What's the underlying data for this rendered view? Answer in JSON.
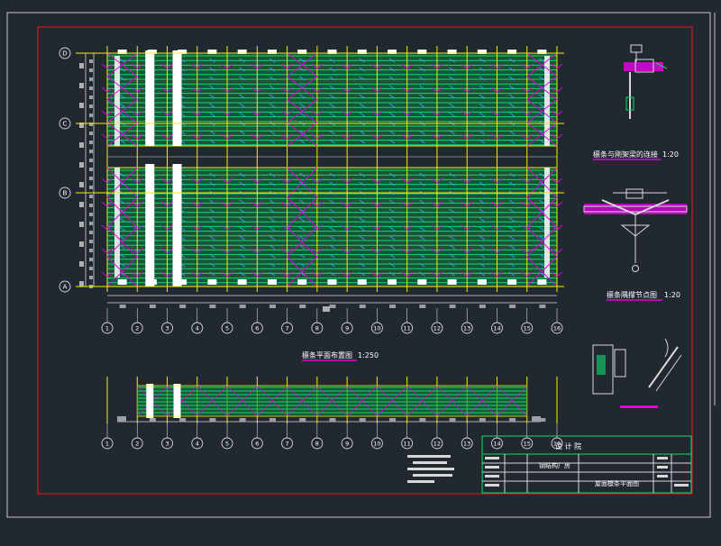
{
  "drawing": {
    "main_plan_title": "檩条平面布置图",
    "main_plan_scale": "1:250",
    "detail1_title": "檩条与刚架梁的连接",
    "detail1_scale": "1:20",
    "detail2_title": "檩条隅撑节点图",
    "detail2_scale": "1:20",
    "row_axes": [
      "D",
      "C",
      "B",
      "A"
    ],
    "column_axes": [
      "1",
      "2",
      "3",
      "4",
      "5",
      "6",
      "7",
      "8",
      "9",
      "10",
      "11",
      "12",
      "13",
      "14",
      "15",
      "16"
    ],
    "lower_axes": [
      "1",
      "2",
      "3",
      "4",
      "5",
      "6",
      "7",
      "8",
      "9",
      "10",
      "11",
      "12",
      "13",
      "14",
      "15",
      "16"
    ]
  },
  "title_block": {
    "header": "设 计 院",
    "project": "钢结构厂房",
    "sheet": "屋面檩条平面图"
  },
  "colors": {
    "background": "#212830",
    "frame": "#e0101a",
    "purlin": "#12d870",
    "axis": "#f2f200",
    "brace": "#e000e0",
    "line": "#d8d8d8",
    "text": "#ffffff"
  }
}
